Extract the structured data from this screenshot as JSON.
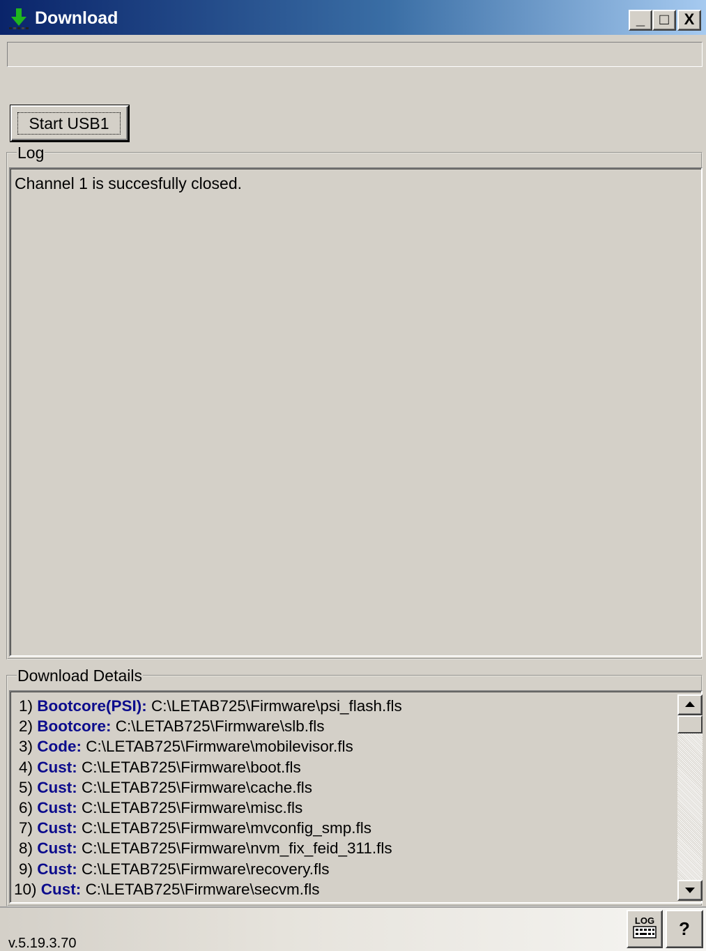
{
  "window": {
    "title": "Download",
    "minimize_glyph": "_",
    "maximize_glyph": "□",
    "close_glyph": "X"
  },
  "toolbar": {
    "start_button_label": "Start USB1"
  },
  "log": {
    "group_label": "Log",
    "lines": [
      "Channel 1 is succesfully closed."
    ]
  },
  "details": {
    "group_label": "Download Details",
    "rows": [
      {
        "num": "1)",
        "label": "Bootcore(PSI):",
        "path": "C:\\LETAB725\\Firmware\\psi_flash.fls"
      },
      {
        "num": "2)",
        "label": "Bootcore:",
        "path": "C:\\LETAB725\\Firmware\\slb.fls"
      },
      {
        "num": "3)",
        "label": "Code:",
        "path": "C:\\LETAB725\\Firmware\\mobilevisor.fls"
      },
      {
        "num": "4)",
        "label": "Cust:",
        "path": "C:\\LETAB725\\Firmware\\boot.fls"
      },
      {
        "num": "5)",
        "label": "Cust:",
        "path": "C:\\LETAB725\\Firmware\\cache.fls"
      },
      {
        "num": "6)",
        "label": "Cust:",
        "path": "C:\\LETAB725\\Firmware\\misc.fls"
      },
      {
        "num": "7)",
        "label": "Cust:",
        "path": "C:\\LETAB725\\Firmware\\mvconfig_smp.fls"
      },
      {
        "num": "8)",
        "label": "Cust:",
        "path": "C:\\LETAB725\\Firmware\\nvm_fix_feid_311.fls"
      },
      {
        "num": "9)",
        "label": "Cust:",
        "path": "C:\\LETAB725\\Firmware\\recovery.fls"
      },
      {
        "num": "10)",
        "label": "Cust:",
        "path": "C:\\LETAB725\\Firmware\\secvm.fls"
      }
    ]
  },
  "status": {
    "version": "v.5.19.3.70",
    "log_button_label": "LOG",
    "help_button_label": "?"
  },
  "colors": {
    "titlebar_start": "#0a246a",
    "titlebar_end": "#a6caf0",
    "face": "#d4d0c8",
    "detail_label": "#0c0c8c"
  },
  "icons": {
    "app": "download-arrow-icon",
    "log": "log-keyboard-icon"
  }
}
